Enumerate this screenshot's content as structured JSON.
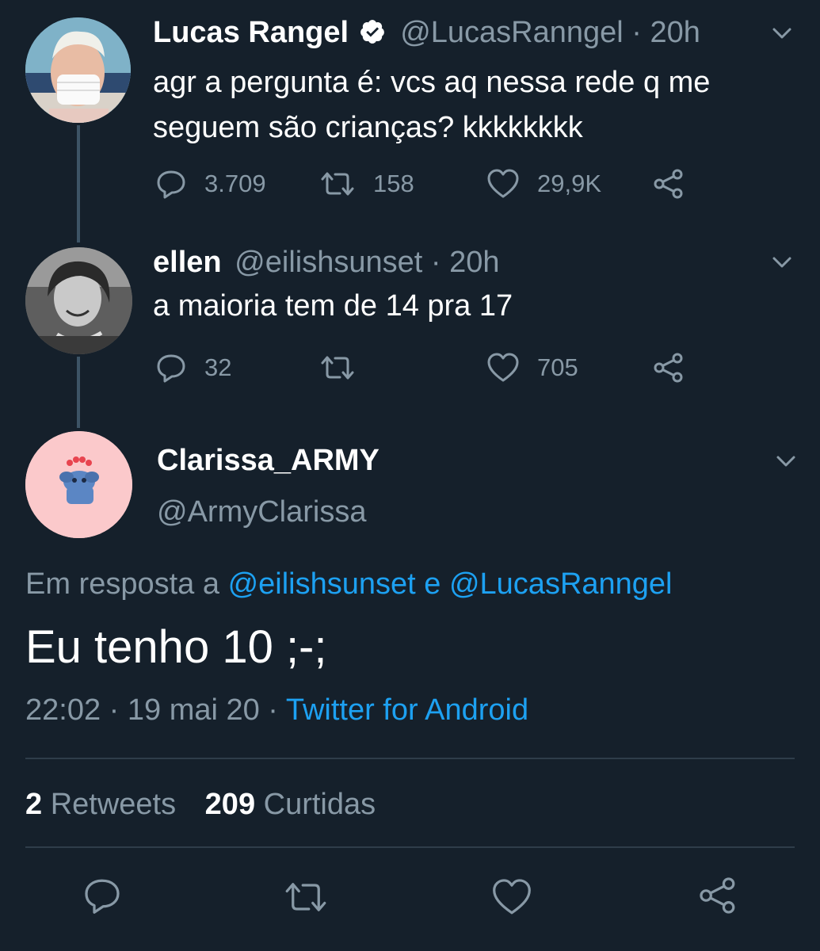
{
  "colors": {
    "background": "#15202b",
    "muted": "#8899a6",
    "link": "#1da1f2",
    "verified": "#ffffff"
  },
  "tweet1": {
    "name": "Lucas Rangel",
    "handle": "@LucasRanngel",
    "time": "· 20h",
    "text_line1": "agr a pergunta é: vcs aq nessa rede q me",
    "text_line2": "seguem são crianças? kkkkkkkk",
    "replies": "3.709",
    "retweets": "158",
    "likes": "29,9K"
  },
  "tweet2": {
    "name": "ellen",
    "handle": "@eilishsunset",
    "time": "· 20h",
    "text": "a maioria tem de 14 pra 17",
    "replies": "32",
    "likes": "705"
  },
  "main_tweet": {
    "name": "Clarissa_ARMY",
    "handle": "@ArmyClarissa",
    "reply_prefix": "Em resposta a",
    "reply_to_1": "@eilishsunset",
    "reply_and": "e",
    "reply_to_2": "@LucasRanngel",
    "text": "Eu tenho 10 ;-;",
    "timestamp": "22:02 · 19 mai 20 ·",
    "source": "Twitter for Android",
    "retweet_count": "2",
    "retweet_label": "Retweets",
    "like_count": "209",
    "like_label": "Curtidas"
  },
  "icons": [
    "verified-badge-icon",
    "chevron-down-icon",
    "reply-icon",
    "retweet-icon",
    "like-icon",
    "share-icon"
  ]
}
